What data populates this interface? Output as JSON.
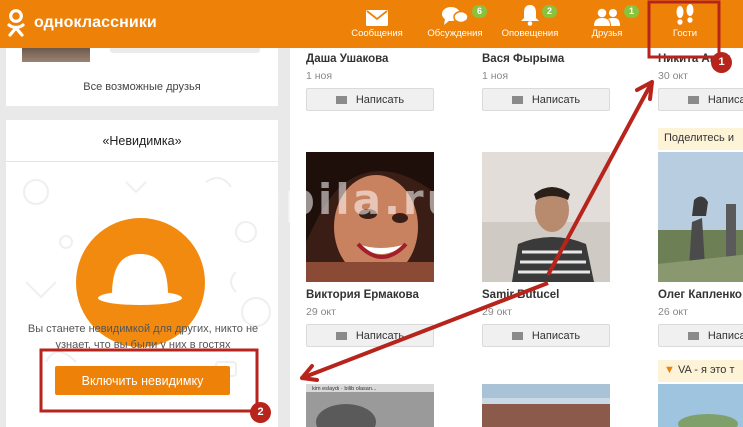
{
  "header": {
    "logo_text": "одноклассники",
    "nav": [
      {
        "label": "Сообщения",
        "icon": "envelope-icon",
        "badge": ""
      },
      {
        "label": "Обсуждения",
        "icon": "chat-bubbles-icon",
        "badge": "6"
      },
      {
        "label": "Оповещения",
        "icon": "bell-icon",
        "badge": "2"
      },
      {
        "label": "Друзья",
        "icon": "friends-icon",
        "badge": "1"
      },
      {
        "label": "Гости",
        "icon": "footprints-icon",
        "badge": ""
      }
    ]
  },
  "sidebar": {
    "all_friends": "Все возможные друзья",
    "invisible": {
      "title": "«Невидимка»",
      "description": "Вы станете невидимкой для других, никто не узнает, что вы были у них в гостях",
      "button": "Включить невидимку"
    }
  },
  "guests": [
    {
      "name": "Даша Ушакова",
      "date": "1 ноя",
      "button": "Написать"
    },
    {
      "name": "Вася Фырыма",
      "date": "1 ноя",
      "button": "Написать"
    },
    {
      "name": "Никита Анон",
      "date": "30 окт",
      "button": "Написать"
    },
    {
      "name": "Виктория Ермакова",
      "date": "29 окт",
      "button": "Написать"
    },
    {
      "name": "Samir Butucel",
      "date": "29 окт",
      "button": "Написать"
    },
    {
      "name": "Олег Капленко",
      "date": "26 окт",
      "button": "Написать"
    }
  ],
  "share_text": "Поделитесь и",
  "va_text": "VA - я это т",
  "photo_caption": "kim eslaydı · bilib olasan...",
  "watermark": "zatupila.ru",
  "annotations": [
    "1",
    "2"
  ],
  "colors": {
    "brand": "#ee8208",
    "badge": "#89c23c",
    "annotation": "#b7241c"
  }
}
